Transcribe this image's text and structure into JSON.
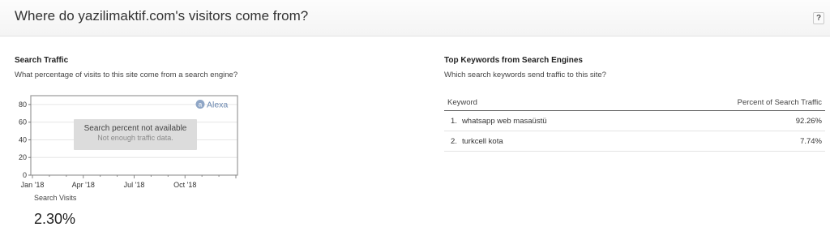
{
  "header": {
    "title": "Where do yazilimaktif.com's visitors come from?",
    "help_label": "?"
  },
  "search_traffic": {
    "title": "Search Traffic",
    "subtitle": "What percentage of visits to this site come from a search engine?",
    "watermark": "Alexa",
    "overlay_title": "Search percent not available",
    "overlay_subtitle": "Not enough traffic data.",
    "metric_label": "Search Visits",
    "metric_value": "2.30%"
  },
  "chart_data": {
    "type": "line",
    "title": "",
    "xlabel": "",
    "ylabel": "",
    "x_ticks": [
      "Jan '18",
      "Apr '18",
      "Jul '18",
      "Oct '18"
    ],
    "y_ticks": [
      0,
      20,
      40,
      60,
      80
    ],
    "ylim": [
      0,
      90
    ],
    "series": [],
    "grid": true
  },
  "keywords": {
    "title": "Top Keywords from Search Engines",
    "subtitle": "Which search keywords send traffic to this site?",
    "columns": [
      "Keyword",
      "Percent of Search Traffic"
    ],
    "rows": [
      {
        "rank": "1.",
        "keyword": "whatsapp web masaüstü",
        "percent": "92.26%"
      },
      {
        "rank": "2.",
        "keyword": "turkcell kota",
        "percent": "7.74%"
      }
    ]
  },
  "colors": {
    "chart_border": "#999999",
    "grid": "#e6e6e6",
    "overlay_bg": "#dcdcdc",
    "alexa_blue": "#6b88b0"
  }
}
